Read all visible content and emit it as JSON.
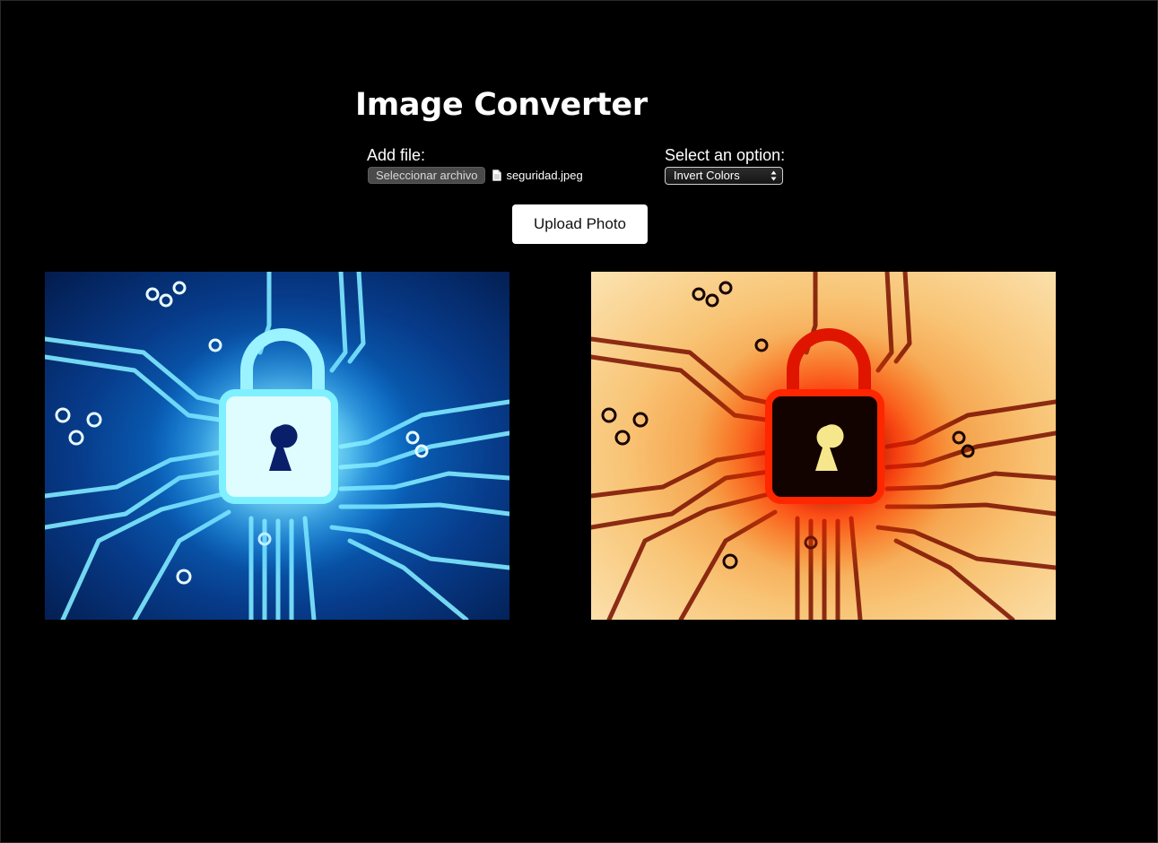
{
  "page": {
    "title": "Image Converter"
  },
  "form": {
    "file_label": "Add file:",
    "file_button_label": "Seleccionar archivo",
    "file_name": "seguridad.jpeg",
    "option_label": "Select an option:",
    "selected_option": "Invert Colors",
    "upload_button_label": "Upload Photo"
  },
  "images": {
    "original": {
      "description_icon": "circuit-lock-image",
      "palette": "blue"
    },
    "converted": {
      "description_icon": "circuit-lock-image-inverted",
      "palette": "inverted"
    }
  },
  "colors": {
    "background": "#000000",
    "text": "#ffffff",
    "button_bg": "#ffffff"
  }
}
